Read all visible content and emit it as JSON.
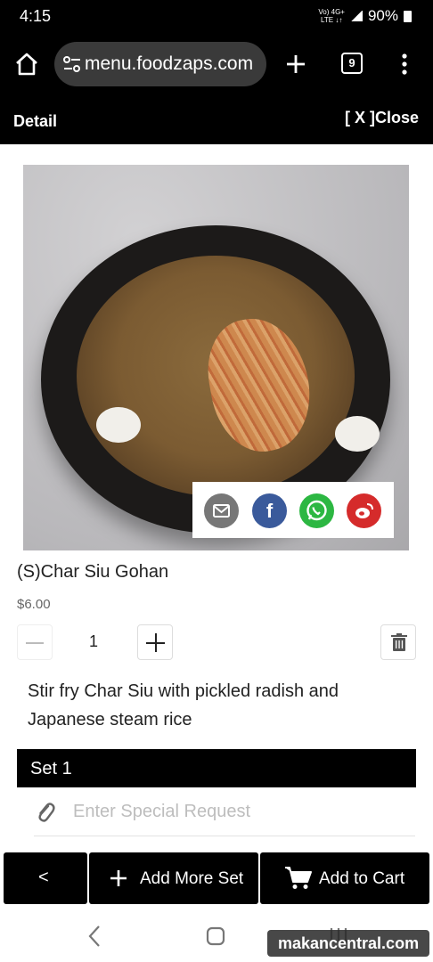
{
  "status_bar": {
    "time": "4:15",
    "network_top": "Vo) 4G+",
    "network_bottom": "LTE ↓↑",
    "battery": "90%"
  },
  "browser": {
    "url": "menu.foodzaps.com",
    "tab_count": "9"
  },
  "header": {
    "title": "Detail",
    "close_label": "[ X ]Close"
  },
  "item": {
    "name": "(S)Char Siu Gohan",
    "price": "$6.00",
    "quantity": "1",
    "description": "Stir fry Char Siu with pickled radish and Japanese steam rice"
  },
  "share": {
    "facebook_glyph": "f"
  },
  "set": {
    "title": "Set 1",
    "special_request_placeholder": "Enter Special Request"
  },
  "actions": {
    "back_glyph": "<",
    "add_more_label": "Add More Set",
    "add_to_cart_label": "Add to Cart"
  },
  "watermark": "makancentral.com",
  "colors": {
    "facebook": "#3a5a9b",
    "whatsapp": "#2cb742",
    "weibo": "#d52b2b",
    "email": "#777777"
  }
}
